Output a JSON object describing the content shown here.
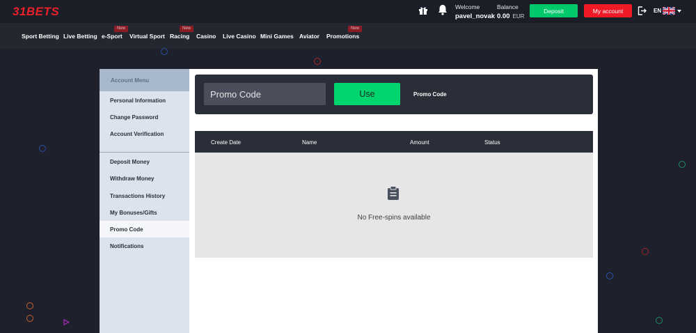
{
  "header": {
    "logo": "31BETS",
    "welcome_label": "Welcome",
    "username": "pavel_novak",
    "balance_label": "Balance",
    "balance_value": "0.00",
    "currency": "EUR",
    "deposit_label": "Deposit",
    "account_label": "My account",
    "language": "EN"
  },
  "nav": {
    "items": [
      {
        "label": "Sport Betting"
      },
      {
        "label": "Live Betting"
      },
      {
        "label": "e-Sport",
        "badge": "New"
      },
      {
        "label": "Virtual Sport"
      },
      {
        "label": "Racing",
        "badge": "New"
      },
      {
        "label": "Casino"
      },
      {
        "label": "Live Casino"
      },
      {
        "label": "Mini Games"
      },
      {
        "label": "Aviator"
      },
      {
        "label": "Promotions",
        "badge": "New"
      }
    ]
  },
  "sidebar": {
    "title": "Account Menu",
    "items": [
      {
        "label": "Personal Information"
      },
      {
        "label": "Change Password"
      },
      {
        "label": "Account Verification"
      },
      {
        "label": "Deposit Money"
      },
      {
        "label": "Withdraw Money"
      },
      {
        "label": "Transactions History"
      },
      {
        "label": "My Bonuses/Gifts"
      },
      {
        "label": "Promo Code"
      },
      {
        "label": "Notifications"
      }
    ],
    "active_item": "Promo Code"
  },
  "promo": {
    "input_placeholder": "Promo Code",
    "use_label": "Use",
    "label": "Promo Code"
  },
  "table": {
    "columns": [
      "Create Date",
      "Name",
      "Amount",
      "Status"
    ],
    "empty_message": "No Free-spins available"
  },
  "colors": {
    "brand_red": "#ef1a26",
    "deposit_green": "#00c96b",
    "use_green": "#00d46e"
  }
}
